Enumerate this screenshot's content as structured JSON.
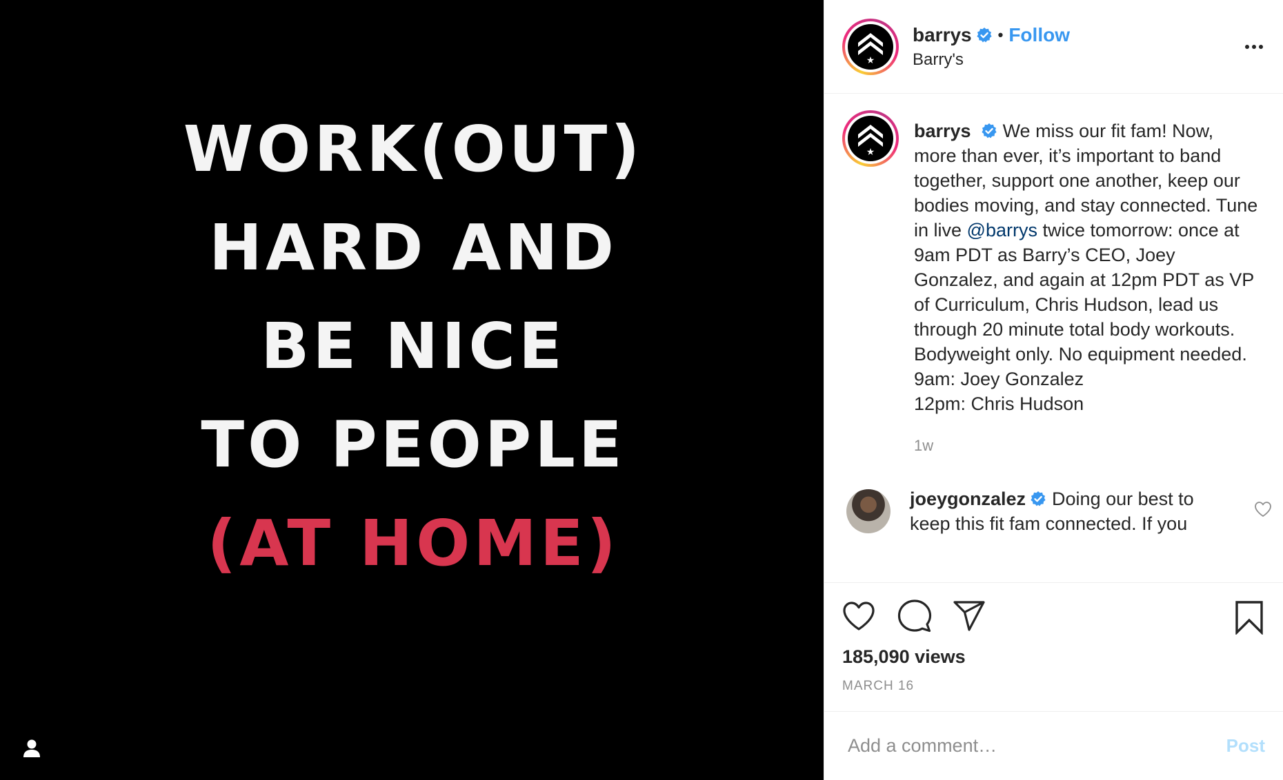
{
  "media": {
    "lines": [
      "WORK(OUT)",
      "HARD AND",
      "BE NICE",
      "TO PEOPLE"
    ],
    "accent_line": "(AT HOME)",
    "accent_color": "#d8364f",
    "tag_icon": "user-icon"
  },
  "header": {
    "username": "barrys",
    "verified_icon": "verified-badge-icon",
    "separator": "•",
    "follow_label": "Follow",
    "subtitle": "Barry's",
    "more_icon": "more-options-icon"
  },
  "caption": {
    "username": "barrys",
    "text_before_mention": "We miss our fit fam! Now, more than ever, it’s important to band together, support one another, keep our bodies moving, and stay connected. Tune in live",
    "mention": "@barrys",
    "text_after_mention": "twice tomorrow: once at 9am PDT as Barry’s CEO, Joey Gonzalez, and again at 12pm PDT as VP of Curriculum, Chris Hudson, lead us through 20 minute total body workouts. Bodyweight only. No equipment needed.",
    "schedule_line_1": "9am: Joey Gonzalez",
    "schedule_line_2": "12pm: Chris Hudson",
    "timestamp": "1w"
  },
  "comment": {
    "username": "joeygonzalez",
    "text": "Doing our best to keep this fit fam connected. If you"
  },
  "actions": {
    "like_icon": "heart-icon",
    "comment_icon": "comment-bubble-icon",
    "share_icon": "paper-plane-icon",
    "save_icon": "bookmark-icon",
    "views_count": "185,090",
    "views_label": "views",
    "date": "MARCH 16"
  },
  "add_comment": {
    "placeholder": "Add a comment…",
    "post_label": "Post"
  },
  "colors": {
    "link_blue": "#3897f0",
    "mention_blue": "#00376b",
    "post_disabled": "#b2dffc",
    "verified_blue": "#3897f0"
  }
}
